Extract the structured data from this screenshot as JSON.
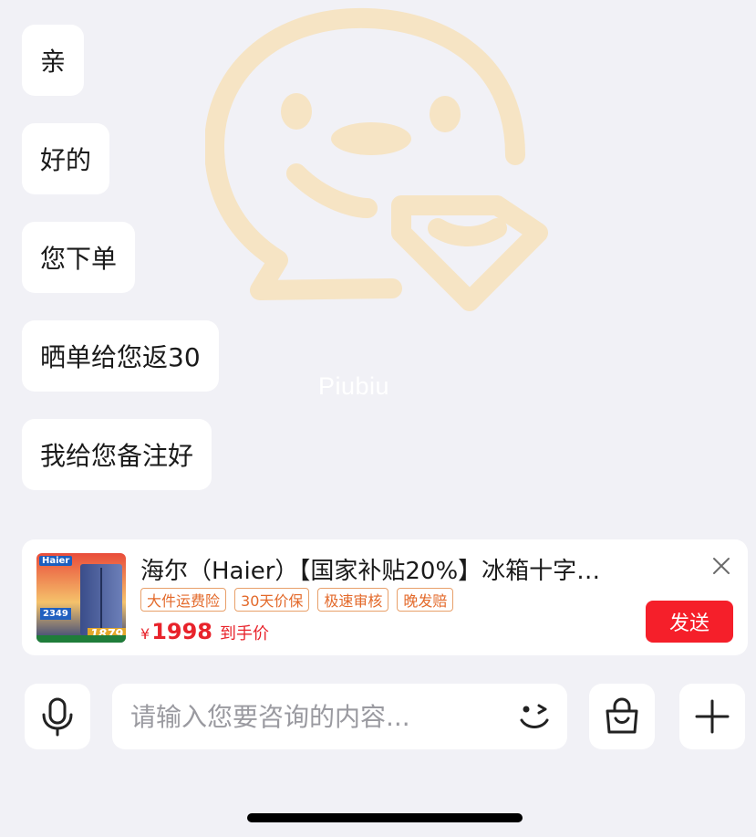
{
  "watermark": {
    "text": "Piubiu"
  },
  "messages": [
    {
      "text": "亲"
    },
    {
      "text": "好的"
    },
    {
      "text": "您下单"
    },
    {
      "text": "晒单给您返30"
    },
    {
      "text": "我给您备注好"
    }
  ],
  "product_card": {
    "image_icon": "product-thumbnail",
    "image_texts": {
      "brand": "Haier",
      "price_a": "2349",
      "price_b": "1879"
    },
    "title": "海尔（Haier）【国家补贴20%】冰箱十字…",
    "tags": [
      "大件运费险",
      "30天价保",
      "极速审核",
      "晚发赔"
    ],
    "price_symbol": "¥",
    "price": "1998",
    "price_note": "到手价",
    "send_label": "发送",
    "close_icon": "close-icon",
    "accent_color": "#f51f2a",
    "tag_color": "#e3692a"
  },
  "input_bar": {
    "placeholder": "请输入您要咨询的内容...",
    "value": "",
    "mic_icon": "microphone-icon",
    "emoji_icon": "wink-emoji-icon",
    "bag_icon": "shopping-bag-icon",
    "plus_icon": "plus-icon"
  },
  "colors": {
    "background": "#f1f1f6",
    "bubble": "#ffffff",
    "watermark": "#f6e4c4"
  }
}
